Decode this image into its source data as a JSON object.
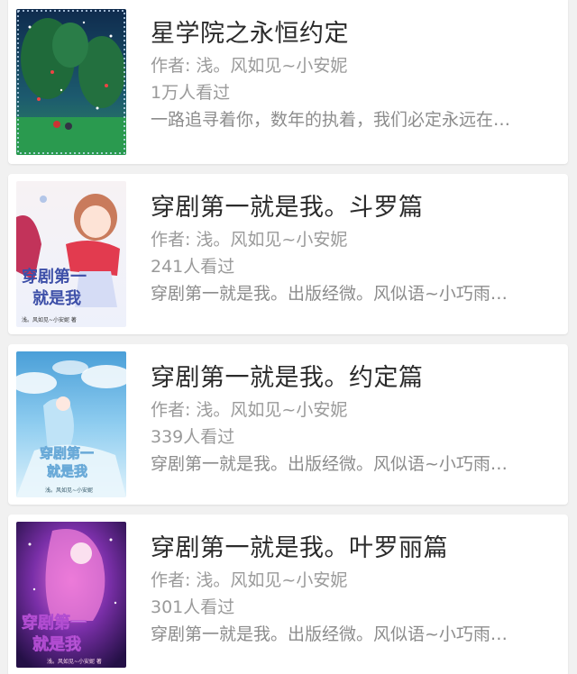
{
  "books": [
    {
      "title": "星学院之永恒约定",
      "author_label": "作者:",
      "author": "浅。风如见~小安妮",
      "views": "1万人看过",
      "description": "一路追寻着你，数年的执着，我们必定永远在…",
      "cover_icon": "starry-forest-cover-image"
    },
    {
      "title": "穿剧第一就是我。斗罗篇",
      "author_label": "作者:",
      "author": "浅。风如见~小安妮",
      "views": "241人看过",
      "description": "穿剧第一就是我。出版经微。风似语~小巧雨…",
      "cover_icon": "anime-girl-cover-image",
      "cover_text": [
        "穿剧第一",
        "就是我",
        "浅。风如见~小安妮 著"
      ]
    },
    {
      "title": "穿剧第一就是我。约定篇",
      "author_label": "作者:",
      "author": "浅。风如见~小安妮",
      "views": "339人看过",
      "description": "穿剧第一就是我。出版经微。风似语~小巧雨…",
      "cover_icon": "blue-sky-girl-cover-image",
      "cover_text": [
        "穿剧第一",
        "就是我",
        "浅。风如见~小安妮"
      ]
    },
    {
      "title": "穿剧第一就是我。叶罗丽篇",
      "author_label": "作者:",
      "author": "浅。风如见~小安妮",
      "views": "301人看过",
      "description": "穿剧第一就是我。出版经微。风似语~小巧雨…",
      "cover_icon": "purple-fairy-cover-image",
      "cover_text": [
        "穿剧第一",
        "就是我",
        "浅。风如见~小安妮 著"
      ]
    }
  ]
}
